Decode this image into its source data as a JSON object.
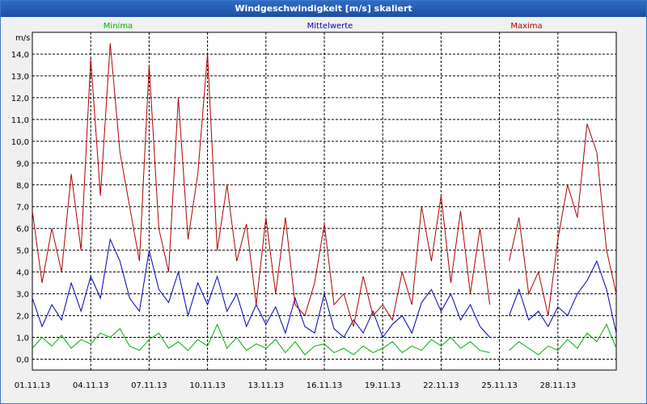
{
  "window": {
    "title": "Windgeschwindigkeit [m/s] skaliert"
  },
  "chart_data": {
    "type": "line",
    "title": "Windgeschwindigkeit [m/s] skaliert",
    "ylabel": "m/s",
    "xlabel": "",
    "ylim": [
      -0.5,
      15.0
    ],
    "y_ticks": [
      0,
      1,
      2,
      3,
      4,
      5,
      6,
      7,
      8,
      9,
      10,
      11,
      12,
      13,
      14
    ],
    "y_tick_labels": [
      "0,0",
      "1,0",
      "2,0",
      "3,0",
      "4,0",
      "5,0",
      "6,0",
      "7,0",
      "8,0",
      "9,0",
      "10,0",
      "11,0",
      "12,0",
      "13,0",
      "14,0"
    ],
    "x_ticks": [
      1,
      4,
      7,
      10,
      13,
      16,
      19,
      22,
      25,
      28
    ],
    "x_tick_labels": [
      "01.11.13",
      "04.11.13",
      "07.11.13",
      "10.11.13",
      "13.11.13",
      "16.11.13",
      "19.11.13",
      "22.11.13",
      "25.11.13",
      "28.11.13"
    ],
    "xlim": [
      1,
      31
    ],
    "grid": true,
    "legend_position": "top",
    "series": [
      {
        "name": "Minima",
        "color": "#00b000",
        "points": [
          [
            1,
            0.5
          ],
          [
            1.5,
            1.0
          ],
          [
            2,
            0.6
          ],
          [
            2.5,
            1.1
          ],
          [
            3,
            0.5
          ],
          [
            3.5,
            0.9
          ],
          [
            4,
            0.7
          ],
          [
            4.5,
            1.2
          ],
          [
            5,
            1.0
          ],
          [
            5.5,
            1.4
          ],
          [
            6,
            0.6
          ],
          [
            6.5,
            0.4
          ],
          [
            7,
            0.9
          ],
          [
            7.5,
            1.2
          ],
          [
            8,
            0.5
          ],
          [
            8.5,
            0.8
          ],
          [
            9,
            0.4
          ],
          [
            9.5,
            0.9
          ],
          [
            10,
            0.6
          ],
          [
            10.5,
            1.6
          ],
          [
            11,
            0.5
          ],
          [
            11.5,
            1.0
          ],
          [
            12,
            0.4
          ],
          [
            12.5,
            0.7
          ],
          [
            13,
            0.5
          ],
          [
            13.5,
            0.9
          ],
          [
            14,
            0.3
          ],
          [
            14.5,
            0.8
          ],
          [
            15,
            0.2
          ],
          [
            15.5,
            0.6
          ],
          [
            16,
            0.7
          ],
          [
            16.5,
            0.3
          ],
          [
            17,
            0.5
          ],
          [
            17.5,
            0.2
          ],
          [
            18,
            0.6
          ],
          [
            18.5,
            0.3
          ],
          [
            19,
            0.5
          ],
          [
            19.5,
            0.8
          ],
          [
            20,
            0.3
          ],
          [
            20.5,
            0.6
          ],
          [
            21,
            0.4
          ],
          [
            21.5,
            0.9
          ],
          [
            22,
            0.6
          ],
          [
            22.5,
            1.0
          ],
          [
            23,
            0.5
          ],
          [
            23.5,
            0.8
          ],
          [
            24,
            0.4
          ],
          [
            24.5,
            0.3
          ],
          [
            null,
            null
          ],
          [
            25.5,
            0.4
          ],
          [
            26,
            0.8
          ],
          [
            26.5,
            0.5
          ],
          [
            27,
            0.2
          ],
          [
            27.5,
            0.6
          ],
          [
            28,
            0.4
          ],
          [
            28.5,
            0.9
          ],
          [
            29,
            0.5
          ],
          [
            29.5,
            1.2
          ],
          [
            30,
            0.8
          ],
          [
            30.5,
            1.6
          ],
          [
            31,
            0.5
          ]
        ]
      },
      {
        "name": "Mittelwerte",
        "color": "#0000b0",
        "points": [
          [
            1,
            2.8
          ],
          [
            1.5,
            1.5
          ],
          [
            2,
            2.5
          ],
          [
            2.5,
            1.8
          ],
          [
            3,
            3.5
          ],
          [
            3.5,
            2.2
          ],
          [
            4,
            3.8
          ],
          [
            4.5,
            2.8
          ],
          [
            5,
            5.5
          ],
          [
            5.5,
            4.5
          ],
          [
            6,
            2.8
          ],
          [
            6.5,
            2.2
          ],
          [
            7,
            5.0
          ],
          [
            7.5,
            3.2
          ],
          [
            8,
            2.6
          ],
          [
            8.5,
            4.0
          ],
          [
            9,
            2.0
          ],
          [
            9.5,
            3.5
          ],
          [
            10,
            2.5
          ],
          [
            10.5,
            3.8
          ],
          [
            11,
            2.2
          ],
          [
            11.5,
            3.0
          ],
          [
            12,
            1.5
          ],
          [
            12.5,
            2.5
          ],
          [
            13,
            1.6
          ],
          [
            13.5,
            2.4
          ],
          [
            14,
            1.2
          ],
          [
            14.5,
            2.8
          ],
          [
            15,
            1.5
          ],
          [
            15.5,
            1.2
          ],
          [
            16,
            3.0
          ],
          [
            16.5,
            1.4
          ],
          [
            17,
            1.0
          ],
          [
            17.5,
            1.8
          ],
          [
            18,
            1.2
          ],
          [
            18.5,
            2.2
          ],
          [
            19,
            1.0
          ],
          [
            19.5,
            1.6
          ],
          [
            20,
            2.0
          ],
          [
            20.5,
            1.2
          ],
          [
            21,
            2.6
          ],
          [
            21.5,
            3.2
          ],
          [
            22,
            2.2
          ],
          [
            22.5,
            3.0
          ],
          [
            23,
            1.8
          ],
          [
            23.5,
            2.5
          ],
          [
            24,
            1.5
          ],
          [
            24.5,
            1.0
          ],
          [
            null,
            null
          ],
          [
            25.5,
            2.0
          ],
          [
            26,
            3.2
          ],
          [
            26.5,
            1.8
          ],
          [
            27,
            2.2
          ],
          [
            27.5,
            1.5
          ],
          [
            28,
            2.4
          ],
          [
            28.5,
            2.0
          ],
          [
            29,
            3.0
          ],
          [
            29.5,
            3.6
          ],
          [
            30,
            4.5
          ],
          [
            30.5,
            3.2
          ],
          [
            31,
            1.2
          ]
        ]
      },
      {
        "name": "Maxima",
        "color": "#b00000",
        "points": [
          [
            1,
            6.8
          ],
          [
            1.5,
            3.5
          ],
          [
            2,
            6.0
          ],
          [
            2.5,
            4.0
          ],
          [
            3,
            8.5
          ],
          [
            3.5,
            5.0
          ],
          [
            4,
            13.8
          ],
          [
            4.5,
            7.5
          ],
          [
            5,
            14.5
          ],
          [
            5.5,
            9.5
          ],
          [
            6,
            7.0
          ],
          [
            6.5,
            4.5
          ],
          [
            7,
            13.5
          ],
          [
            7.5,
            6.0
          ],
          [
            8,
            4.0
          ],
          [
            8.5,
            12.0
          ],
          [
            9,
            5.5
          ],
          [
            9.5,
            8.5
          ],
          [
            10,
            14.0
          ],
          [
            10.5,
            5.0
          ],
          [
            11,
            8.0
          ],
          [
            11.5,
            4.5
          ],
          [
            12,
            6.2
          ],
          [
            12.5,
            2.5
          ],
          [
            13,
            6.5
          ],
          [
            13.5,
            3.0
          ],
          [
            14,
            6.5
          ],
          [
            14.5,
            2.5
          ],
          [
            15,
            2.0
          ],
          [
            15.5,
            3.5
          ],
          [
            16,
            6.2
          ],
          [
            16.5,
            2.5
          ],
          [
            17,
            3.0
          ],
          [
            17.5,
            1.5
          ],
          [
            18,
            3.8
          ],
          [
            18.5,
            2.0
          ],
          [
            19,
            2.5
          ],
          [
            19.5,
            1.8
          ],
          [
            20,
            4.0
          ],
          [
            20.5,
            2.5
          ],
          [
            21,
            7.0
          ],
          [
            21.5,
            4.5
          ],
          [
            22,
            7.5
          ],
          [
            22.5,
            3.5
          ],
          [
            23,
            6.8
          ],
          [
            23.5,
            3.0
          ],
          [
            24,
            6.0
          ],
          [
            24.5,
            2.5
          ],
          [
            null,
            null
          ],
          [
            25.5,
            4.5
          ],
          [
            26,
            6.5
          ],
          [
            26.5,
            3.0
          ],
          [
            27,
            4.0
          ],
          [
            27.5,
            2.0
          ],
          [
            28,
            5.5
          ],
          [
            28.5,
            8.0
          ],
          [
            29,
            6.5
          ],
          [
            29.5,
            10.8
          ],
          [
            30,
            9.5
          ],
          [
            30.5,
            5.0
          ],
          [
            31,
            3.0
          ]
        ]
      }
    ]
  }
}
